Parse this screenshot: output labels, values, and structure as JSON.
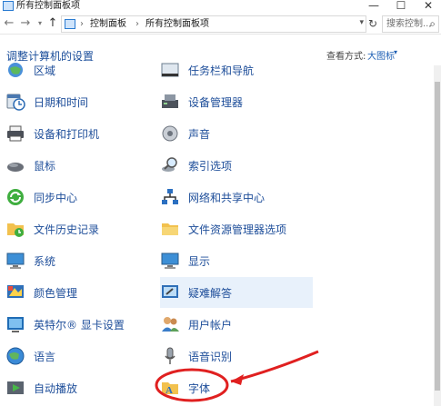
{
  "window": {
    "title": "所有控制面板项",
    "min_glyph": "—",
    "max_glyph": "☐",
    "close_glyph": "✕"
  },
  "nav": {
    "back_glyph": "←",
    "forward_glyph": "→",
    "recent_glyph": "▾",
    "up_glyph": "↑",
    "breadcrumb": [
      "控制面板",
      "所有控制面板项"
    ],
    "breadcrumb_sep": "›",
    "address_drop_glyph": "▾",
    "refresh_glyph": "↻",
    "search_placeholder": "搜索控制...",
    "search_glyph": "⌕"
  },
  "header": {
    "title": "调整计算机的设置",
    "view_by_label": "查看方式:",
    "view_by_value": "大图标",
    "view_by_caret": "▾"
  },
  "items_left": [
    {
      "label": "区域",
      "icon": "region-icon"
    },
    {
      "label": "日期和时间",
      "icon": "date-time-icon"
    },
    {
      "label": "设备和打印机",
      "icon": "printer-icon"
    },
    {
      "label": "鼠标",
      "icon": "mouse-icon"
    },
    {
      "label": "同步中心",
      "icon": "sync-icon"
    },
    {
      "label": "文件历史记录",
      "icon": "file-history-icon"
    },
    {
      "label": "系统",
      "icon": "system-icon"
    },
    {
      "label": "颜色管理",
      "icon": "color-management-icon"
    },
    {
      "label": "英特尔® 显卡设置",
      "icon": "intel-graphics-icon"
    },
    {
      "label": "语言",
      "icon": "language-icon"
    },
    {
      "label": "自动播放",
      "icon": "autoplay-icon"
    }
  ],
  "items_right": [
    {
      "label": "任务栏和导航",
      "icon": "taskbar-icon"
    },
    {
      "label": "设备管理器",
      "icon": "device-manager-icon"
    },
    {
      "label": "声音",
      "icon": "sound-icon"
    },
    {
      "label": "索引选项",
      "icon": "indexing-icon"
    },
    {
      "label": "网络和共享中心",
      "icon": "network-icon"
    },
    {
      "label": "文件资源管理器选项",
      "icon": "folder-options-icon"
    },
    {
      "label": "显示",
      "icon": "display-icon"
    },
    {
      "label": "疑难解答",
      "icon": "troubleshooting-icon"
    },
    {
      "label": "用户帐户",
      "icon": "user-accounts-icon"
    },
    {
      "label": "语音识别",
      "icon": "speech-icon"
    },
    {
      "label": "字体",
      "icon": "fonts-icon"
    }
  ],
  "colors": {
    "link": "#1e4e9a",
    "annotation": "#e02020",
    "hover": "#e8f1fb"
  }
}
